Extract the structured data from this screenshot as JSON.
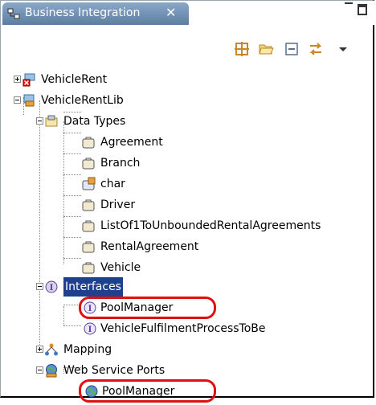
{
  "view": {
    "title": "Business Integration",
    "close_glyph": "✕"
  },
  "toolbar": {
    "buttons": [
      "grid-icon",
      "open-folder-icon",
      "collapse-all-icon",
      "link-editor-icon",
      "view-menu-icon"
    ]
  },
  "tree": {
    "vehicle_rent": "VehicleRent",
    "vehicle_rent_lib": "VehicleRentLib",
    "data_types": {
      "label": "Data Types",
      "items": [
        "Agreement",
        "Branch",
        "char",
        "Driver",
        "ListOf1ToUnboundedRentalAgreements",
        "RentalAgreement",
        "Vehicle"
      ]
    },
    "interfaces": {
      "label": "Interfaces",
      "items": [
        "PoolManager",
        "VehicleFulfilmentProcessToBe"
      ]
    },
    "mapping": "Mapping",
    "web_service_ports": {
      "label": "Web Service Ports",
      "items": [
        "PoolManager"
      ]
    }
  },
  "colors": {
    "tab_blue": "#5d7da4",
    "selection": "#1f3f8f",
    "highlight_red": "#e01010"
  }
}
